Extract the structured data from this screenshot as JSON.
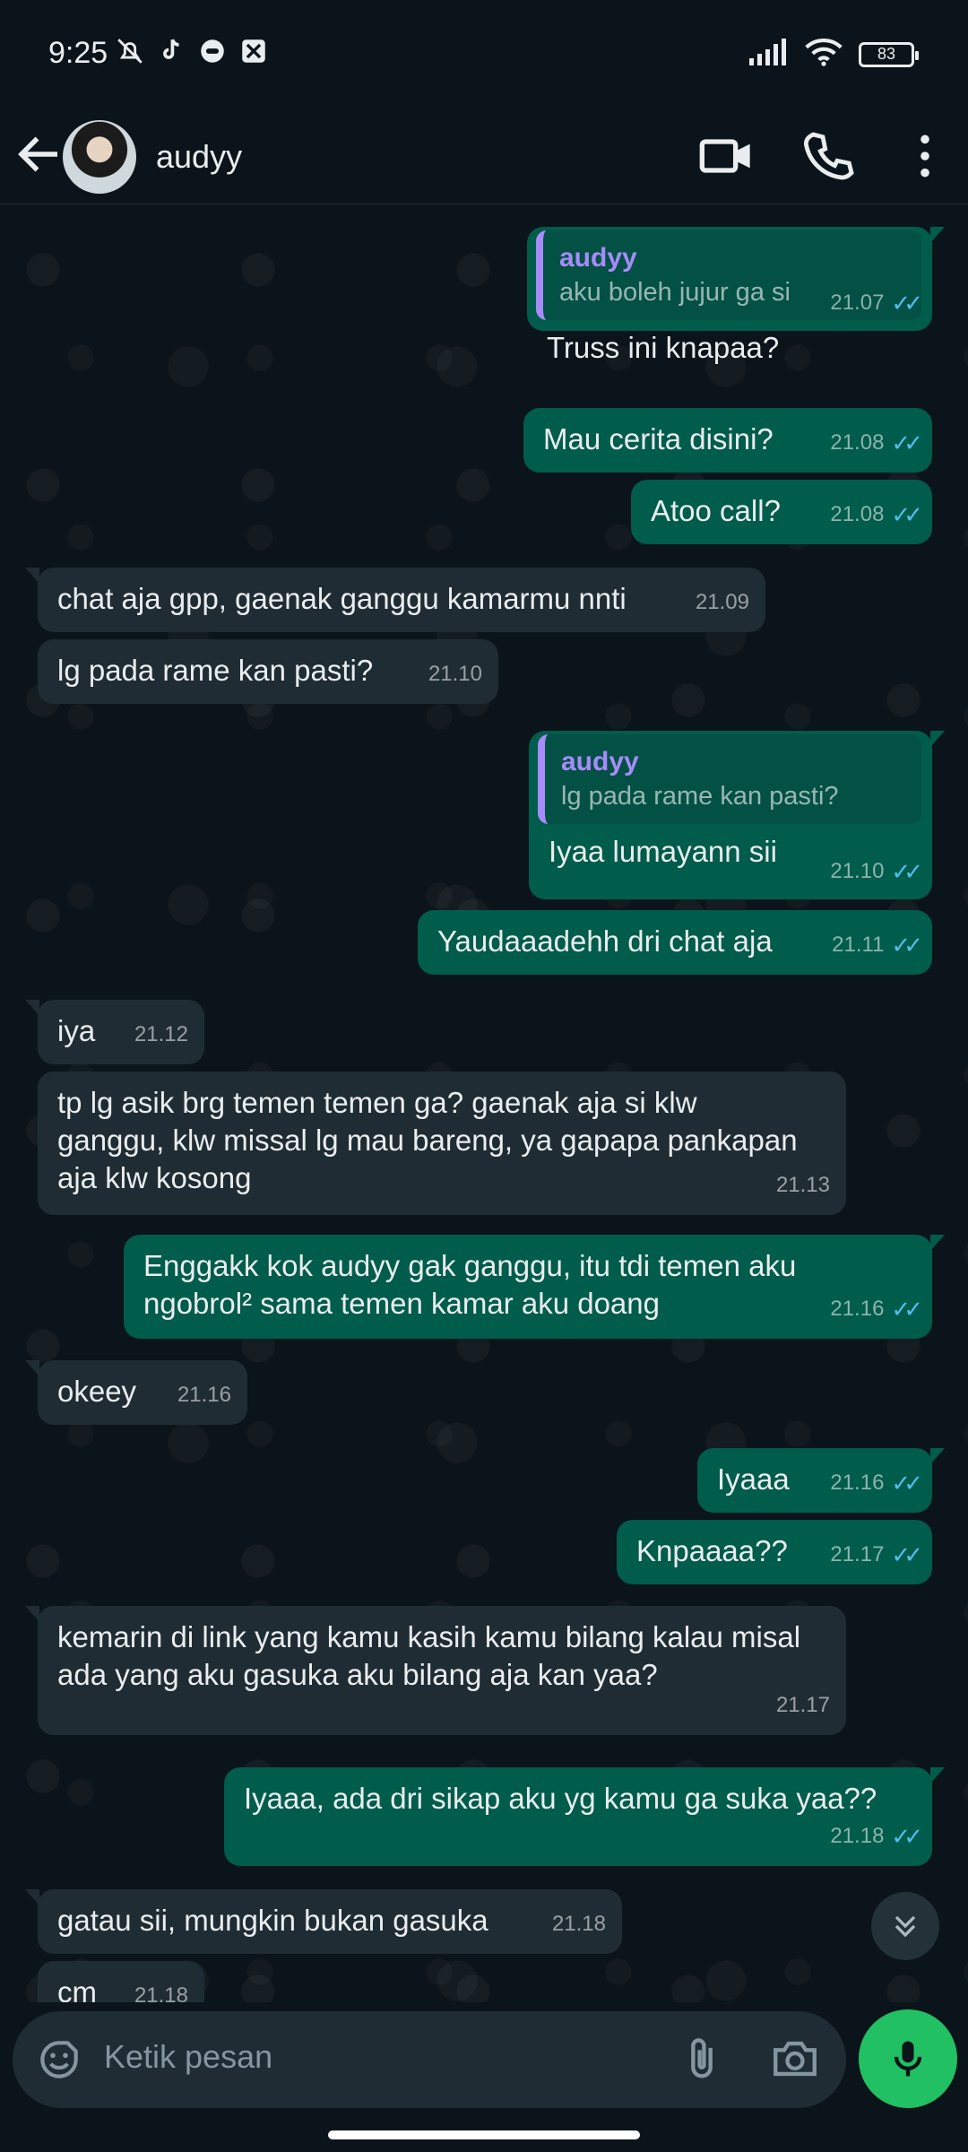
{
  "status_bar": {
    "time": "9:25",
    "battery": "83"
  },
  "header": {
    "contact_name": "audyy"
  },
  "messages": [
    {
      "dir": "out",
      "quote_name": "audyy",
      "quote_text": "aku boleh jujur ga si",
      "text": "Truss ini knapaa?",
      "time": "21.07"
    },
    {
      "dir": "out",
      "text": "Mau cerita disini?",
      "time": "21.08"
    },
    {
      "dir": "out",
      "text": "Atoo call?",
      "time": "21.08"
    },
    {
      "dir": "in",
      "text": "chat aja gpp, gaenak ganggu kamarmu nnti",
      "time": "21.09"
    },
    {
      "dir": "in",
      "text": "lg pada rame kan pasti?",
      "time": "21.10"
    },
    {
      "dir": "out",
      "quote_name": "audyy",
      "quote_text": "lg pada rame kan pasti?",
      "text": "Iyaa lumayann sii",
      "time": "21.10"
    },
    {
      "dir": "out",
      "text": "Yaudaaadehh dri chat aja",
      "time": "21.11"
    },
    {
      "dir": "in",
      "text": "iya",
      "time": "21.12"
    },
    {
      "dir": "in",
      "text": "tp lg asik brg temen temen ga? gaenak aja si klw ganggu, klw missal lg mau bareng, ya gapapa pankapan aja klw kosong",
      "time": "21.13"
    },
    {
      "dir": "out",
      "text": "Enggakk kok audyy gak ganggu, itu tdi temen aku ngobrol² sama temen kamar aku doang",
      "time": "21.16"
    },
    {
      "dir": "in",
      "text": "okeey",
      "time": "21.16"
    },
    {
      "dir": "out",
      "text": "Iyaaa",
      "time": "21.16"
    },
    {
      "dir": "out",
      "text": "Knpaaaa??",
      "time": "21.17"
    },
    {
      "dir": "in",
      "text": "kemarin di link yang kamu kasih kamu bilang kalau misal ada yang aku gasuka aku bilang aja kan yaa?",
      "time": "21.17"
    },
    {
      "dir": "out",
      "text": "Iyaaa, ada dri sikap aku yg kamu ga suka yaa??",
      "time": "21.18"
    },
    {
      "dir": "in",
      "text": "gatau sii, mungkin bukan gasuka",
      "time": "21.18"
    },
    {
      "dir": "in",
      "text": "cm",
      "time": "21.18"
    }
  ],
  "composer": {
    "placeholder": "Ketik pesan"
  },
  "colors": {
    "incoming": "#202c33",
    "outgoing": "#005c4b",
    "read_ticks": "#53bdeb",
    "mic": "#21c063"
  },
  "icons": [
    "back-arrow-icon",
    "video-call-icon",
    "voice-call-icon",
    "more-menu-icon",
    "emoji-icon",
    "attach-icon",
    "camera-icon",
    "mic-icon",
    "scroll-down-icon"
  ]
}
